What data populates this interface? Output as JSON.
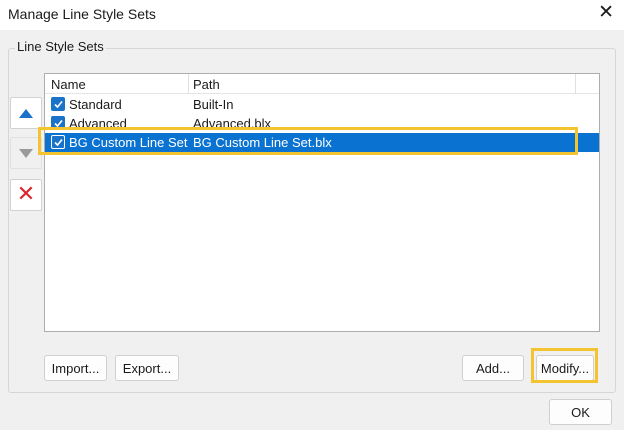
{
  "window": {
    "title": "Manage Line Style Sets"
  },
  "group": {
    "label": "Line Style Sets"
  },
  "list": {
    "columns": [
      "Name",
      "Path"
    ],
    "rows": [
      {
        "name": "Standard",
        "path": "Built-In",
        "checked": true,
        "selected": false
      },
      {
        "name": "Advanced",
        "path": "Advanced.blx",
        "checked": true,
        "selected": false
      },
      {
        "name": "BG Custom Line Set",
        "path": "BG Custom Line Set.blx",
        "checked": true,
        "selected": true
      }
    ]
  },
  "side_buttons": {
    "up_icon": "arrow-up-icon",
    "down_icon": "arrow-down-icon",
    "remove_icon": "red-x-icon"
  },
  "buttons": {
    "import": "Import...",
    "export": "Export...",
    "add": "Add...",
    "modify": "Modify...",
    "ok": "OK"
  },
  "colors": {
    "selection": "#0a73d1",
    "highlight": "#f4c430",
    "accent_blue": "#1a73c9",
    "remove_red": "#d9262c"
  }
}
